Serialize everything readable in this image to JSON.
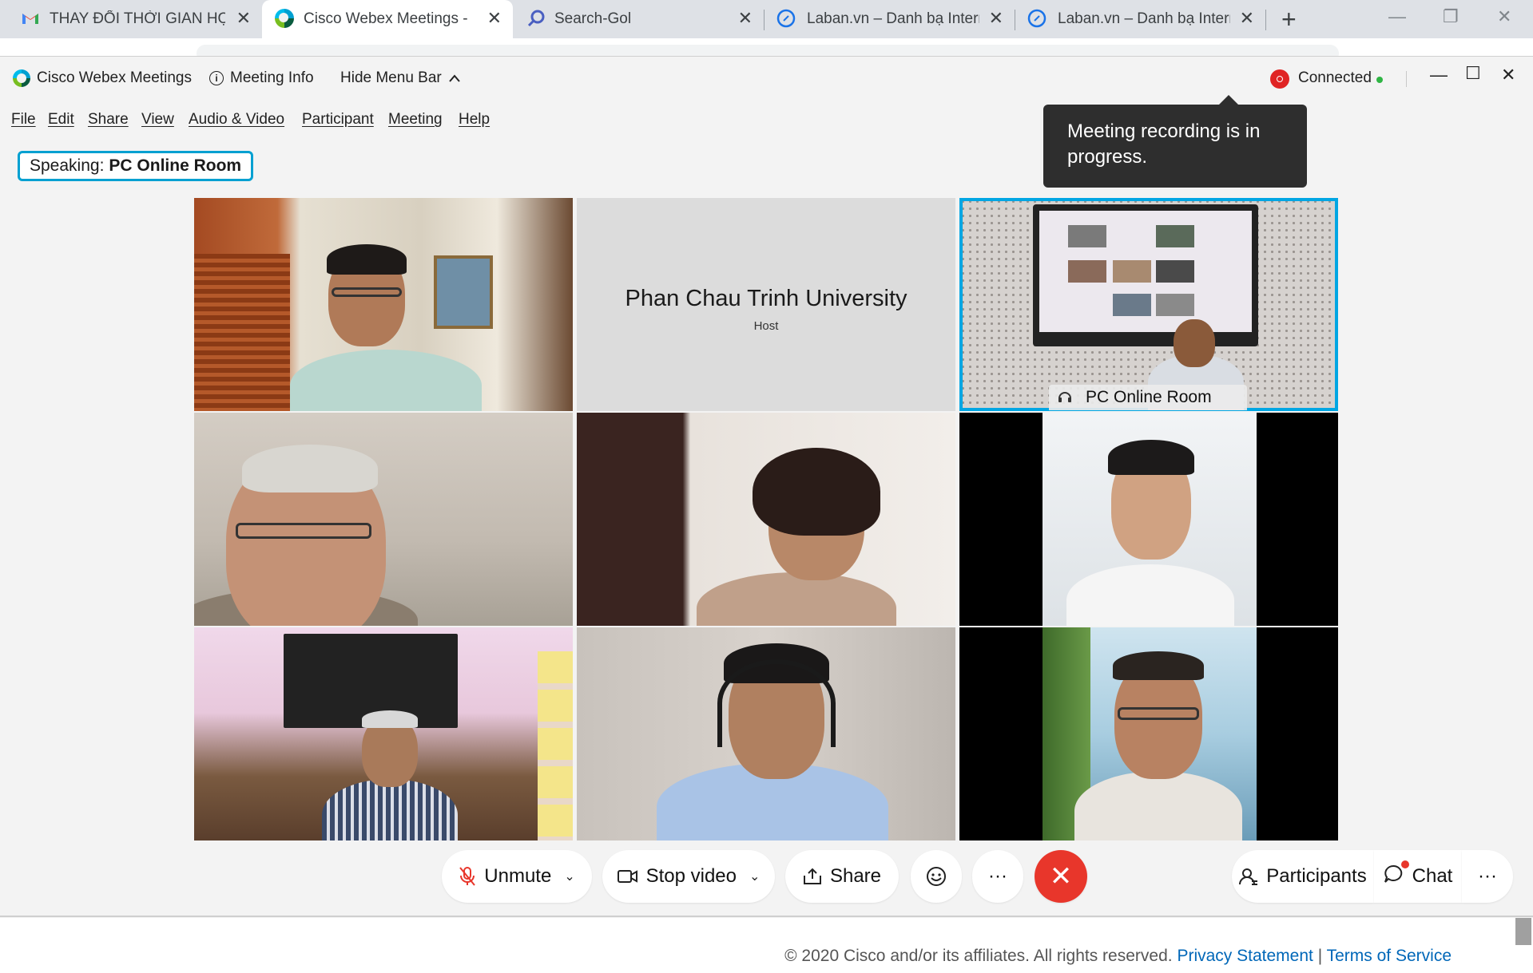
{
  "browser": {
    "tabs": [
      {
        "title": "THAY ĐỔI THỜI GIAN HỌP",
        "icon": "gmail-icon",
        "active": false
      },
      {
        "title": "Cisco Webex Meetings - La",
        "icon": "webex-icon",
        "active": true
      },
      {
        "title": "Search-Gol",
        "icon": "search-icon",
        "active": false
      },
      {
        "title": "Laban.vn – Danh bạ Interne",
        "icon": "compass-icon",
        "active": false
      },
      {
        "title": "Laban.vn – Danh bạ Interne",
        "icon": "compass-icon",
        "active": false
      }
    ],
    "new_tab": "+",
    "close_glyph": "✕"
  },
  "webex": {
    "app_name": "Cisco Webex Meetings",
    "meeting_info": "Meeting Info",
    "hide_menu_bar": "Hide Menu Bar",
    "status": "Connected",
    "menu": [
      "File",
      "Edit",
      "Share",
      "View",
      "Audio & Video",
      "Participant",
      "Meeting",
      "Help"
    ],
    "speaking_prefix": "Speaking:",
    "speaking_name": "PC Online Room",
    "tooltip": "Meeting recording is in progress."
  },
  "grid": {
    "host_name": "Phan Chau Trinh University",
    "host_role": "Host",
    "room_label": "PC Online Room"
  },
  "controls": {
    "unmute": "Unmute",
    "stop_video": "Stop video",
    "share": "Share",
    "more": "···",
    "participants": "Participants",
    "chat": "Chat",
    "end": "✕"
  },
  "footer": {
    "copyright": "© 2020 Cisco and/or its affiliates. All rights reserved.",
    "privacy": "Privacy Statement",
    "separator": "|",
    "terms": "Terms of Service"
  },
  "colors": {
    "accent": "#00a0d1",
    "end_call": "#e8362b",
    "recording": "#e02424",
    "connected": "#2fb544",
    "link": "#0067b8"
  }
}
